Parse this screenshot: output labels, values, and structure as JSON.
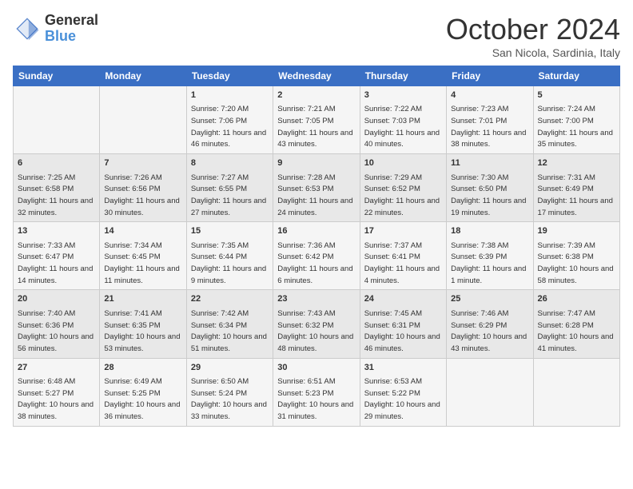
{
  "logo": {
    "line1": "General",
    "line2": "Blue"
  },
  "title": "October 2024",
  "subtitle": "San Nicola, Sardinia, Italy",
  "days_of_week": [
    "Sunday",
    "Monday",
    "Tuesday",
    "Wednesday",
    "Thursday",
    "Friday",
    "Saturday"
  ],
  "weeks": [
    [
      {
        "day": "",
        "info": ""
      },
      {
        "day": "",
        "info": ""
      },
      {
        "day": "1",
        "info": "Sunrise: 7:20 AM\nSunset: 7:06 PM\nDaylight: 11 hours and 46 minutes."
      },
      {
        "day": "2",
        "info": "Sunrise: 7:21 AM\nSunset: 7:05 PM\nDaylight: 11 hours and 43 minutes."
      },
      {
        "day": "3",
        "info": "Sunrise: 7:22 AM\nSunset: 7:03 PM\nDaylight: 11 hours and 40 minutes."
      },
      {
        "day": "4",
        "info": "Sunrise: 7:23 AM\nSunset: 7:01 PM\nDaylight: 11 hours and 38 minutes."
      },
      {
        "day": "5",
        "info": "Sunrise: 7:24 AM\nSunset: 7:00 PM\nDaylight: 11 hours and 35 minutes."
      }
    ],
    [
      {
        "day": "6",
        "info": "Sunrise: 7:25 AM\nSunset: 6:58 PM\nDaylight: 11 hours and 32 minutes."
      },
      {
        "day": "7",
        "info": "Sunrise: 7:26 AM\nSunset: 6:56 PM\nDaylight: 11 hours and 30 minutes."
      },
      {
        "day": "8",
        "info": "Sunrise: 7:27 AM\nSunset: 6:55 PM\nDaylight: 11 hours and 27 minutes."
      },
      {
        "day": "9",
        "info": "Sunrise: 7:28 AM\nSunset: 6:53 PM\nDaylight: 11 hours and 24 minutes."
      },
      {
        "day": "10",
        "info": "Sunrise: 7:29 AM\nSunset: 6:52 PM\nDaylight: 11 hours and 22 minutes."
      },
      {
        "day": "11",
        "info": "Sunrise: 7:30 AM\nSunset: 6:50 PM\nDaylight: 11 hours and 19 minutes."
      },
      {
        "day": "12",
        "info": "Sunrise: 7:31 AM\nSunset: 6:49 PM\nDaylight: 11 hours and 17 minutes."
      }
    ],
    [
      {
        "day": "13",
        "info": "Sunrise: 7:33 AM\nSunset: 6:47 PM\nDaylight: 11 hours and 14 minutes."
      },
      {
        "day": "14",
        "info": "Sunrise: 7:34 AM\nSunset: 6:45 PM\nDaylight: 11 hours and 11 minutes."
      },
      {
        "day": "15",
        "info": "Sunrise: 7:35 AM\nSunset: 6:44 PM\nDaylight: 11 hours and 9 minutes."
      },
      {
        "day": "16",
        "info": "Sunrise: 7:36 AM\nSunset: 6:42 PM\nDaylight: 11 hours and 6 minutes."
      },
      {
        "day": "17",
        "info": "Sunrise: 7:37 AM\nSunset: 6:41 PM\nDaylight: 11 hours and 4 minutes."
      },
      {
        "day": "18",
        "info": "Sunrise: 7:38 AM\nSunset: 6:39 PM\nDaylight: 11 hours and 1 minute."
      },
      {
        "day": "19",
        "info": "Sunrise: 7:39 AM\nSunset: 6:38 PM\nDaylight: 10 hours and 58 minutes."
      }
    ],
    [
      {
        "day": "20",
        "info": "Sunrise: 7:40 AM\nSunset: 6:36 PM\nDaylight: 10 hours and 56 minutes."
      },
      {
        "day": "21",
        "info": "Sunrise: 7:41 AM\nSunset: 6:35 PM\nDaylight: 10 hours and 53 minutes."
      },
      {
        "day": "22",
        "info": "Sunrise: 7:42 AM\nSunset: 6:34 PM\nDaylight: 10 hours and 51 minutes."
      },
      {
        "day": "23",
        "info": "Sunrise: 7:43 AM\nSunset: 6:32 PM\nDaylight: 10 hours and 48 minutes."
      },
      {
        "day": "24",
        "info": "Sunrise: 7:45 AM\nSunset: 6:31 PM\nDaylight: 10 hours and 46 minutes."
      },
      {
        "day": "25",
        "info": "Sunrise: 7:46 AM\nSunset: 6:29 PM\nDaylight: 10 hours and 43 minutes."
      },
      {
        "day": "26",
        "info": "Sunrise: 7:47 AM\nSunset: 6:28 PM\nDaylight: 10 hours and 41 minutes."
      }
    ],
    [
      {
        "day": "27",
        "info": "Sunrise: 6:48 AM\nSunset: 5:27 PM\nDaylight: 10 hours and 38 minutes."
      },
      {
        "day": "28",
        "info": "Sunrise: 6:49 AM\nSunset: 5:25 PM\nDaylight: 10 hours and 36 minutes."
      },
      {
        "day": "29",
        "info": "Sunrise: 6:50 AM\nSunset: 5:24 PM\nDaylight: 10 hours and 33 minutes."
      },
      {
        "day": "30",
        "info": "Sunrise: 6:51 AM\nSunset: 5:23 PM\nDaylight: 10 hours and 31 minutes."
      },
      {
        "day": "31",
        "info": "Sunrise: 6:53 AM\nSunset: 5:22 PM\nDaylight: 10 hours and 29 minutes."
      },
      {
        "day": "",
        "info": ""
      },
      {
        "day": "",
        "info": ""
      }
    ]
  ]
}
